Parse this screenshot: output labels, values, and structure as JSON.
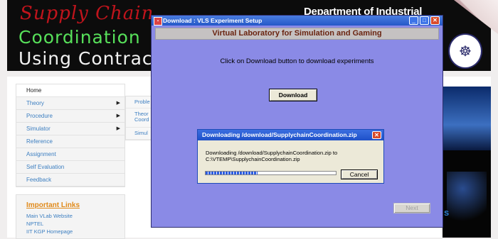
{
  "banner": {
    "line1": "Supply Chain",
    "line2": "Coordination",
    "line3": "Using Contracts",
    "department": "Department of Industrial"
  },
  "nav": {
    "items": [
      {
        "label": "Home",
        "has_arrow": false
      },
      {
        "label": "Theory",
        "has_arrow": true
      },
      {
        "label": "Procedure",
        "has_arrow": true
      },
      {
        "label": "Simulator",
        "has_arrow": true
      },
      {
        "label": "Reference",
        "has_arrow": false
      },
      {
        "label": "Assignment",
        "has_arrow": false
      },
      {
        "label": "Self Evaluation",
        "has_arrow": false
      },
      {
        "label": "Feedback",
        "has_arrow": false
      }
    ],
    "arrow_glyph": "▶",
    "submenu": [
      "Proble",
      "Theor\nCoord",
      "Simul"
    ]
  },
  "important_links": {
    "title": "Important Links",
    "links": [
      "Main VLab Website",
      "NPTEL",
      "IIT KGP Homepage"
    ]
  },
  "photo_text": "s",
  "dialog": {
    "title": "Download : VLS Experiment Setup",
    "header": "Virtual Laboratory for Simulation and Gaming",
    "instruction": "Click on Download button to download experiments",
    "download_label": "Download",
    "next_label": "Next",
    "minimize_glyph": "_",
    "maximize_glyph": "□",
    "close_glyph": "✕"
  },
  "progress": {
    "title": "Downloading /download/SupplychainCoordination.zip",
    "message_line1": "Downloading /download/SupplychainCoordination.zip  to",
    "message_line2": "C:\\VTEMP\\SupplychainCoordination.zip",
    "percent": 40,
    "cancel_label": "Cancel",
    "close_glyph": "✕"
  },
  "colors": {
    "dialog_bg": "#8a8ae6",
    "titlebar_blue": "#2458c8",
    "header_text": "#6a2410",
    "link_blue": "#3d7fc1",
    "links_title": "#e08a1a"
  }
}
